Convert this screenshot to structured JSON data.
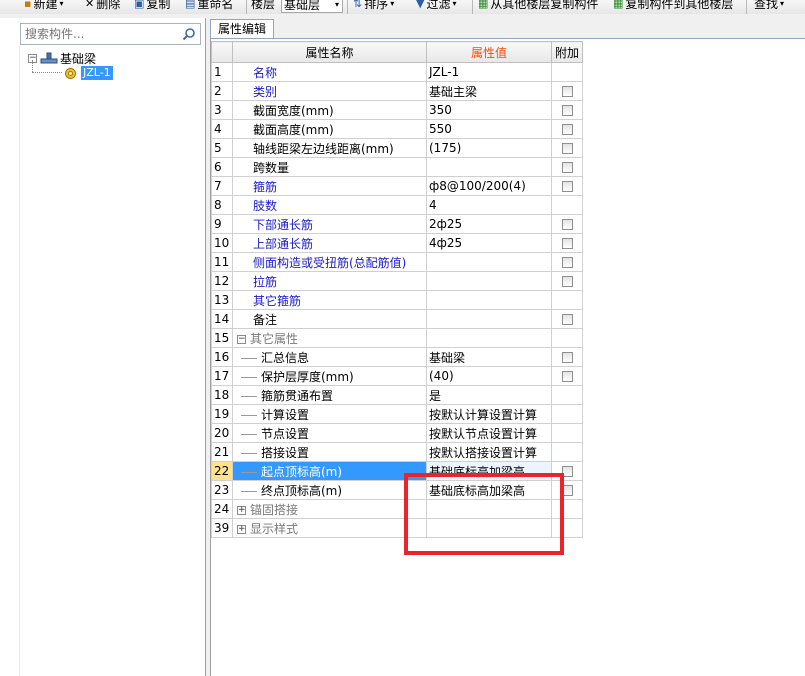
{
  "toolbar": {
    "new_label": "新建",
    "delete_label": "删除",
    "copy_label": "复制",
    "rename_label": "重命名",
    "floor_label": "楼层",
    "floor_value": "基础层",
    "sort_label": "排序",
    "filter_label": "过滤",
    "copy_from_label": "从其他楼层复制构件",
    "copy_to_label": "复制构件到其他楼层",
    "find_label": "查找"
  },
  "search": {
    "placeholder": "搜索构件..."
  },
  "tree": {
    "root_label": "基础梁",
    "child_label": "JZL-1"
  },
  "tab": {
    "label": "属性编辑"
  },
  "grid": {
    "headers": {
      "name": "属性名称",
      "value": "属性值",
      "extra": "附加"
    },
    "rows": [
      {
        "num": "1",
        "name": "名称",
        "value": "JZL-1",
        "check": false
      },
      {
        "num": "2",
        "name": "类别",
        "value": "基础主梁",
        "check": true
      },
      {
        "num": "3",
        "name": "截面宽度(mm)",
        "value": "350",
        "check": true
      },
      {
        "num": "4",
        "name": "截面高度(mm)",
        "value": "550",
        "check": true
      },
      {
        "num": "5",
        "name": "轴线距梁左边线距离(mm)",
        "value": "(175)",
        "check": true
      },
      {
        "num": "6",
        "name": "跨数量",
        "value": "",
        "check": true
      },
      {
        "num": "7",
        "name": "箍筋",
        "value": "ф8@100/200(4)",
        "check": true
      },
      {
        "num": "8",
        "name": "肢数",
        "value": "4",
        "check": false
      },
      {
        "num": "9",
        "name": "下部通长筋",
        "value": "2ф25",
        "check": true
      },
      {
        "num": "10",
        "name": "上部通长筋",
        "value": "4ф25",
        "check": true
      },
      {
        "num": "11",
        "name": "侧面构造或受扭筋(总配筋值)",
        "value": "",
        "check": true
      },
      {
        "num": "12",
        "name": "拉筋",
        "value": "",
        "check": true
      },
      {
        "num": "13",
        "name": "其它箍筋",
        "value": "",
        "check": false
      },
      {
        "num": "14",
        "name": "备注",
        "value": "",
        "check": true
      },
      {
        "num": "15",
        "name": "其它属性",
        "value": "",
        "check": false
      },
      {
        "num": "16",
        "name": "汇总信息",
        "value": "基础梁",
        "check": true
      },
      {
        "num": "17",
        "name": "保护层厚度(mm)",
        "value": "(40)",
        "check": true
      },
      {
        "num": "18",
        "name": "箍筋贯通布置",
        "value": "是",
        "check": false
      },
      {
        "num": "19",
        "name": "计算设置",
        "value": "按默认计算设置计算",
        "check": false
      },
      {
        "num": "20",
        "name": "节点设置",
        "value": "按默认节点设置计算",
        "check": false
      },
      {
        "num": "21",
        "name": "搭接设置",
        "value": "按默认搭接设置计算",
        "check": false
      },
      {
        "num": "22",
        "name": "起点顶标高(m)",
        "value": "基础底标高加梁高",
        "check": true
      },
      {
        "num": "23",
        "name": "终点顶标高(m)",
        "value": "基础底标高加梁高",
        "check": true
      },
      {
        "num": "24",
        "name": "锚固搭接",
        "value": "",
        "check": false
      },
      {
        "num": "39",
        "name": "显示样式",
        "value": "",
        "check": false
      }
    ]
  }
}
